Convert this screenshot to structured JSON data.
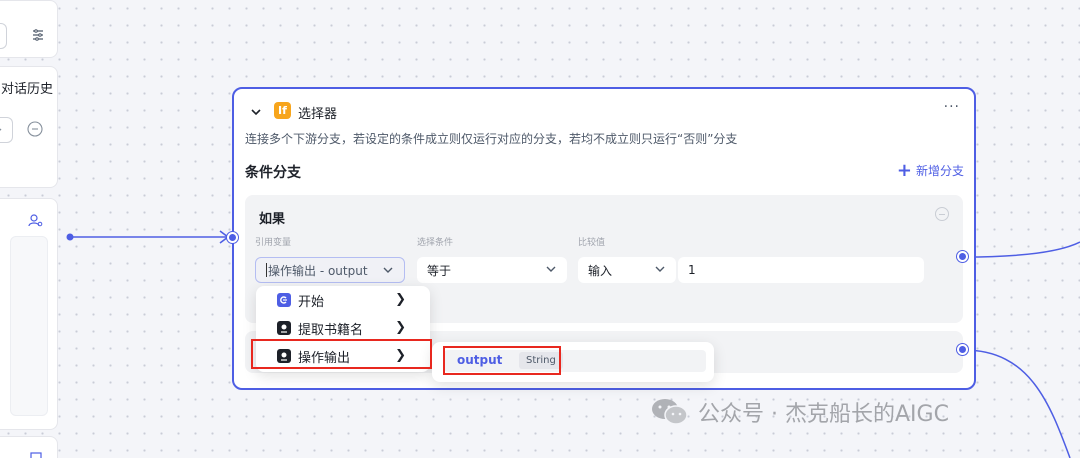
{
  "left_panel": {
    "history_label": "对话历史"
  },
  "node": {
    "badge": "If",
    "title": "选择器",
    "more": "···",
    "description": "连接多个下游分支，若设定的条件成立则仅运行对应的分支，若均不成立则只运行“否则”分支",
    "section_title": "条件分支",
    "add_branch": "新增分支",
    "branch": {
      "label": "如果",
      "ref_var_label": "引用变量",
      "condition_label": "选择条件",
      "compare_label": "比较值",
      "ref_var_value": "操作输出 - output",
      "condition_value": "等于",
      "compare_type": "输入",
      "compare_value": "1"
    }
  },
  "dropdown": {
    "items": [
      {
        "label": "开始",
        "icon": "start-icon"
      },
      {
        "label": "提取书籍名",
        "icon": "llm-icon"
      },
      {
        "label": "操作输出",
        "icon": "llm-icon"
      }
    ]
  },
  "submenu": {
    "name": "output",
    "type": "String"
  },
  "watermark": {
    "text": "公众号 · 杰克船长的AIGC"
  },
  "colors": {
    "accent": "#4e5ee4",
    "highlight_box": "#e8281f",
    "if_badge": "#f7a51c"
  }
}
